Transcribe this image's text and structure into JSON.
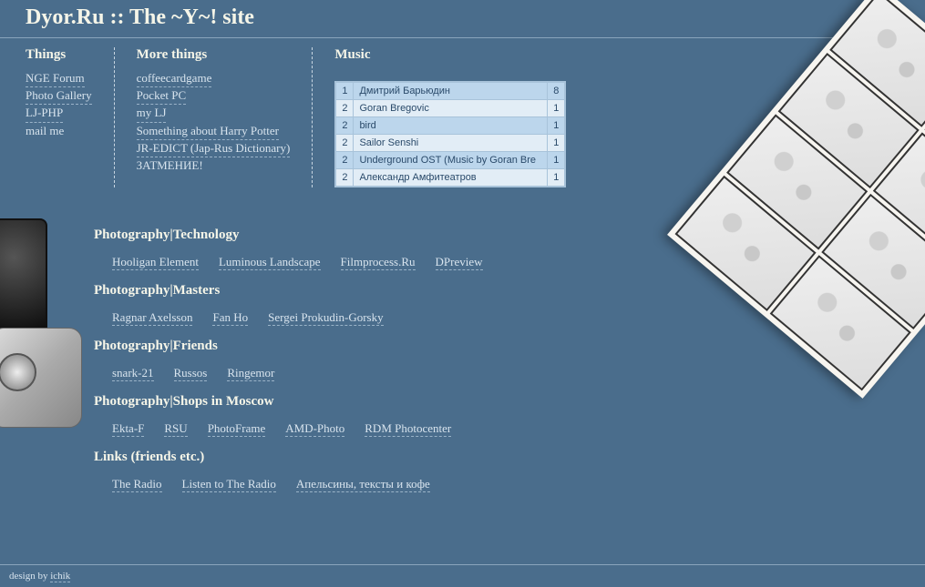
{
  "site_title": "Dyor.Ru :: The ~Y~! site",
  "cols": {
    "things": {
      "heading": "Things",
      "links": [
        "NGE Forum",
        "Photo Gallery",
        "LJ-PHP",
        "mail me"
      ]
    },
    "more_things": {
      "heading": "More things",
      "links": [
        "coffeecardgame",
        "Pocket PC",
        "my LJ",
        "Something about Harry Potter",
        "JR-EDICT (Jap-Rus Dictionary)",
        "ЗАТМЕНИЕ!"
      ]
    },
    "music": {
      "heading": "Music",
      "rows": [
        {
          "n": "1",
          "title": "Дмитрий Барьюдин",
          "c": "8"
        },
        {
          "n": "2",
          "title": "Goran Bregovic",
          "c": "1"
        },
        {
          "n": "2",
          "title": "bird",
          "c": "1"
        },
        {
          "n": "2",
          "title": "Sailor Senshi",
          "c": "1"
        },
        {
          "n": "2",
          "title": "Underground OST (Music by Goran Bre",
          "c": "1"
        },
        {
          "n": "2",
          "title": "Александр Амфитеатров",
          "c": "1"
        }
      ]
    }
  },
  "sections": [
    {
      "heading": "Photography|Technology",
      "links": [
        "Hooligan Element",
        "Luminous Landscape",
        "Filmprocess.Ru",
        "DPreview"
      ]
    },
    {
      "heading": "Photography|Masters",
      "links": [
        "Ragnar Axelsson",
        "Fan Ho",
        "Sergei Prokudin-Gorsky"
      ]
    },
    {
      "heading": "Photography|Friends",
      "links": [
        "snark-21",
        "Russos",
        "Ringemor"
      ]
    },
    {
      "heading": "Photography|Shops in Moscow",
      "links": [
        "Ekta-F",
        "RSU",
        "PhotoFrame",
        "AMD-Photo",
        "RDM Photocenter"
      ]
    },
    {
      "heading": "Links (friends etc.)",
      "links": [
        "The Radio",
        "Listen to The Radio",
        "Апельсины, тексты и кофе"
      ]
    }
  ],
  "footer": {
    "prefix": "design by ",
    "credit": "ichik"
  }
}
